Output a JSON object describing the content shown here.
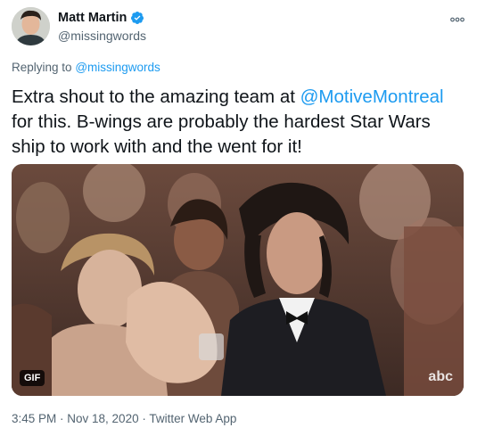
{
  "author": {
    "display_name": "Matt Martin",
    "handle": "@missingwords",
    "verified": true,
    "avatar_icon": "profile-photo"
  },
  "more_icon": "more-options-icon",
  "reply": {
    "prefix": "Replying to",
    "to": "@missingwords"
  },
  "tweet": {
    "text_before": "Extra shout to the amazing team at ",
    "mention": "@MotiveMontreal",
    "text_after": " for this. B-wings are probably the hardest Star Wars ship to work with and the went for it!"
  },
  "media": {
    "badge": "GIF",
    "watermark": "abc"
  },
  "meta": {
    "timestamp": "3:45 PM · Nov 18, 2020 · Twitter Web App"
  },
  "colors": {
    "accent": "#1d9bf0",
    "secondary_text": "#536471",
    "primary_text": "#0f1419"
  }
}
